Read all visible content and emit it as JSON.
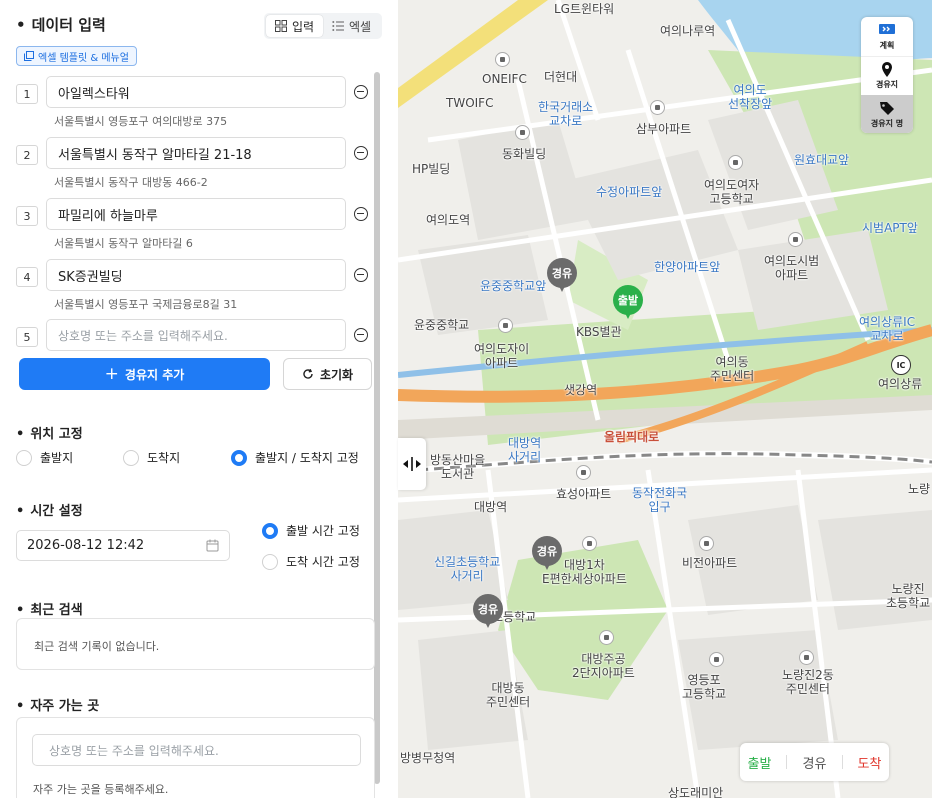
{
  "panel": {
    "title": "데이터 입력",
    "mode_tabs": [
      {
        "label": "입력",
        "icon": "grid-icon",
        "active": true
      },
      {
        "label": "엑셀",
        "icon": "list-icon",
        "active": false
      }
    ],
    "template_link": "엑셀 템플릿 & 메뉴얼",
    "waypoints": [
      {
        "index": "1",
        "name": "아일렉스타워",
        "address": "서울특별시 영등포구 여의대방로 375"
      },
      {
        "index": "2",
        "name": "서울특별시 동작구 알마타길 21-18",
        "address": "서울특별시 동작구 대방동 466-2"
      },
      {
        "index": "3",
        "name": "파밀리에 하늘마루",
        "address": "서울특별시 동작구 알마타길 6"
      },
      {
        "index": "4",
        "name": "SK증권빌딩",
        "address": "서울특별시 영등포구 국제금융로8길 31"
      },
      {
        "index": "5",
        "placeholder": "상호명 또는 주소를 입력해주세요."
      }
    ],
    "add_button": "경유지 추가",
    "reset_button": "초기화",
    "location_fix": {
      "title": "위치 고정",
      "options": [
        {
          "label": "출발지",
          "checked": false
        },
        {
          "label": "도착지",
          "checked": false
        },
        {
          "label": "출발지 / 도착지 고정",
          "checked": true
        }
      ]
    },
    "time_setting": {
      "title": "시간 설정",
      "value": "2026-08-12 12:42",
      "options": [
        {
          "label": "출발 시간 고정",
          "checked": true
        },
        {
          "label": "도착 시간 고정",
          "checked": false
        }
      ]
    },
    "recent_search": {
      "title": "최근 검색",
      "empty_text": "최근 검색 기록이 없습니다."
    },
    "favorites": {
      "title": "자주 가는 곳",
      "placeholder": "상호명 또는 주소를 입력해주세요.",
      "empty_text": "자주 가는 곳을 등록해주세요."
    }
  },
  "map": {
    "labels": [
      {
        "text": "LG트윈타워",
        "color": "dark"
      },
      {
        "text": "여의나루역",
        "color": "dark"
      },
      {
        "text": "ONEIFC",
        "color": "dark"
      },
      {
        "text": "더현대",
        "color": "dark"
      },
      {
        "text": "TWOIFC",
        "color": "dark"
      },
      {
        "text": "한국거래소\n교차로",
        "color": "blue"
      },
      {
        "text": "여의도\n선착장앞",
        "color": "blue"
      },
      {
        "text": "삼부아파트",
        "color": "dark"
      },
      {
        "text": "동화빌딩",
        "color": "dark"
      },
      {
        "text": "원효대교앞",
        "color": "blue"
      },
      {
        "text": "HP빌딩",
        "color": "dark"
      },
      {
        "text": "수정아파트앞",
        "color": "blue"
      },
      {
        "text": "여의도여자\n고등학교",
        "color": "dark"
      },
      {
        "text": "여의도역",
        "color": "dark"
      },
      {
        "text": "시범APT앞",
        "color": "blue"
      },
      {
        "text": "여의도시범\n아파트",
        "color": "dark"
      },
      {
        "text": "한양아파트앞",
        "color": "blue"
      },
      {
        "text": "윤중중학교앞",
        "color": "blue"
      },
      {
        "text": "윤중중학교",
        "color": "dark"
      },
      {
        "text": "KBS별관",
        "color": "dark"
      },
      {
        "text": "여의상류IC\n교차로",
        "color": "blue"
      },
      {
        "text": "여의도자이\n아파트",
        "color": "dark"
      },
      {
        "text": "여의동\n주민센터",
        "color": "dark"
      },
      {
        "text": "샛강역",
        "color": "dark"
      },
      {
        "text": "여의상류",
        "color": "dark"
      },
      {
        "text": "올림픽대로",
        "color": "red"
      },
      {
        "text": "대방역\n사거리",
        "color": "blue"
      },
      {
        "text": "방동산마을\n도서관",
        "color": "dark"
      },
      {
        "text": "효성아파트",
        "color": "dark"
      },
      {
        "text": "노량",
        "color": "dark"
      },
      {
        "text": "대방역",
        "color": "dark"
      },
      {
        "text": "동작전화국\n입구",
        "color": "blue"
      },
      {
        "text": "신길초등학교\n사거리",
        "color": "blue"
      },
      {
        "text": "대방1차\nE편한세상아파트",
        "color": "dark"
      },
      {
        "text": "비전아파트",
        "color": "dark"
      },
      {
        "text": "노량진\n초등학교",
        "color": "dark"
      },
      {
        "text": "초등학교",
        "color": "dark"
      },
      {
        "text": "대방주공\n2단지아파트",
        "color": "dark"
      },
      {
        "text": "영등포\n고등학교",
        "color": "dark"
      },
      {
        "text": "노량진2동\n주민센터",
        "color": "dark"
      },
      {
        "text": "대방동\n주민센터",
        "color": "dark"
      },
      {
        "text": "방병무청역",
        "color": "dark"
      },
      {
        "text": "상도래미안",
        "color": "dark"
      }
    ],
    "pins": [
      {
        "label": "경유",
        "color": "#6b6b6b"
      },
      {
        "label": "출발",
        "color": "#2ab04a"
      },
      {
        "label": "경유",
        "color": "#6b6b6b"
      },
      {
        "label": "경유",
        "color": "#6b6b6b"
      }
    ],
    "tools": [
      {
        "label": "계획",
        "icon": "route-plan-icon",
        "active": false
      },
      {
        "label": "경유지",
        "icon": "location-pin-icon",
        "active": false
      },
      {
        "label": "경유지 명",
        "icon": "tag-icon",
        "active": true
      }
    ],
    "legend": [
      {
        "label": "출발",
        "color": "#2ab04a"
      },
      {
        "label": "경유",
        "color": "#555555"
      },
      {
        "label": "도착",
        "color": "#e0352b"
      }
    ],
    "ic_badge": "IC"
  }
}
